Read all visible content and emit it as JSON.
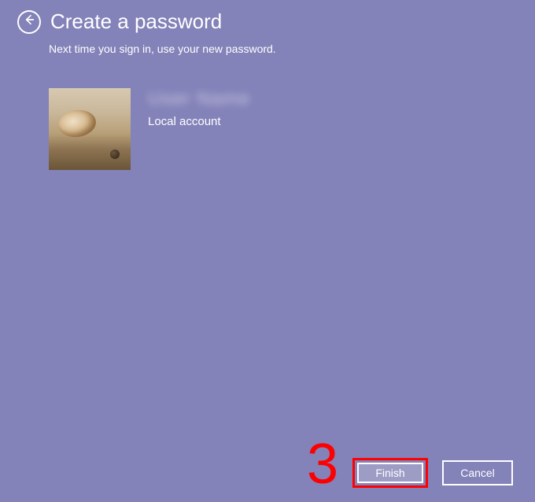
{
  "header": {
    "title": "Create a password",
    "subtitle": "Next time you sign in, use your new password."
  },
  "account": {
    "name_blurred": "User Name",
    "type": "Local account"
  },
  "buttons": {
    "finish": "Finish",
    "cancel": "Cancel"
  },
  "annotation": {
    "step_number": "3"
  }
}
